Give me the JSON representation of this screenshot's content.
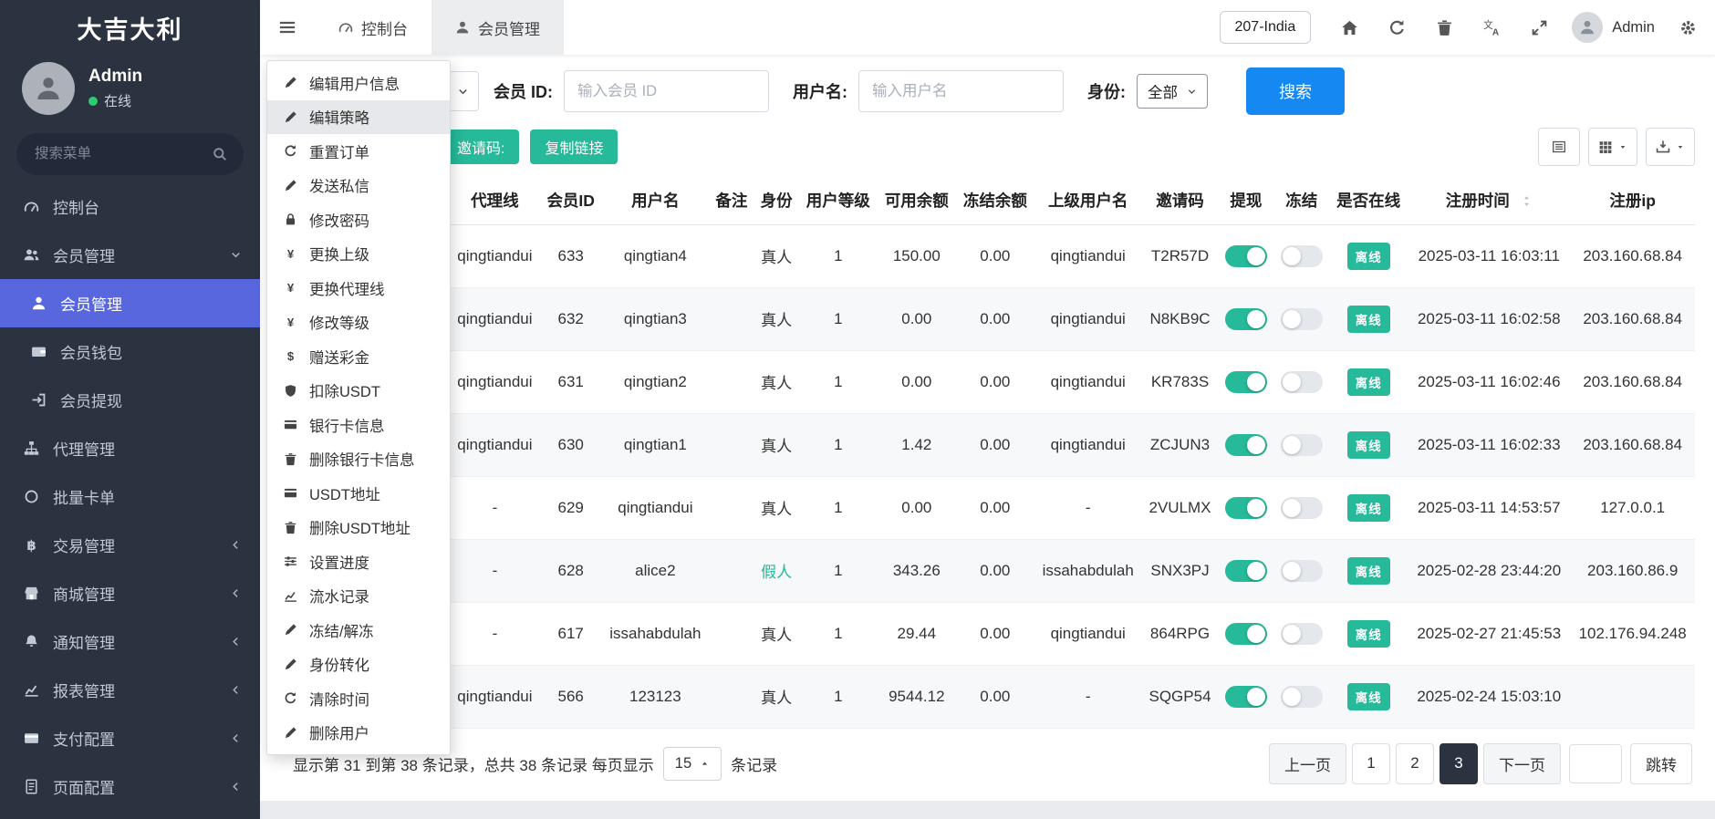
{
  "colors": {
    "accent_teal": "#26b99a",
    "primary_blue": "#1688f2",
    "active_indigo": "#5867dd",
    "sidebar_dark": "#2b3240",
    "online_green": "#2ecc71"
  },
  "sidebar": {
    "title": "大吉大利",
    "user_name": "Admin",
    "user_status": "在线",
    "search_placeholder": "搜索菜单",
    "items": [
      {
        "label": "控制台",
        "icon": "dashboard"
      },
      {
        "label": "会员管理",
        "icon": "users",
        "expanded": true,
        "children": [
          {
            "label": "会员管理",
            "icon": "user",
            "active": true
          },
          {
            "label": "会员钱包",
            "icon": "wallet"
          },
          {
            "label": "会员提现",
            "icon": "withdraw"
          }
        ]
      },
      {
        "label": "代理管理",
        "icon": "sitemap"
      },
      {
        "label": "批量卡单",
        "icon": "circle"
      },
      {
        "label": "交易管理",
        "icon": "bitcoin",
        "collapsible": true
      },
      {
        "label": "商城管理",
        "icon": "store",
        "collapsible": true
      },
      {
        "label": "通知管理",
        "icon": "bell",
        "collapsible": true
      },
      {
        "label": "报表管理",
        "icon": "chart",
        "collapsible": true
      },
      {
        "label": "支付配置",
        "icon": "card",
        "collapsible": true
      },
      {
        "label": "页面配置",
        "icon": "page",
        "collapsible": true
      }
    ]
  },
  "topbar": {
    "tabs": [
      {
        "label": "控制台",
        "icon": "dashboard"
      },
      {
        "label": "会员管理",
        "icon": "user",
        "active": true
      }
    ],
    "region_label": "207-India",
    "user_name": "Admin"
  },
  "context_menu": {
    "items": [
      {
        "label": "编辑用户信息",
        "icon": "pencil"
      },
      {
        "label": "编辑策略",
        "icon": "pencil",
        "highlighted": true
      },
      {
        "label": "重置订单",
        "icon": "refresh"
      },
      {
        "label": "发送私信",
        "icon": "pencil"
      },
      {
        "label": "修改密码",
        "icon": "lock"
      },
      {
        "label": "更换上级",
        "icon": "yen"
      },
      {
        "label": "更换代理线",
        "icon": "yen"
      },
      {
        "label": "修改等级",
        "icon": "yen"
      },
      {
        "label": "赠送彩金",
        "icon": "dollar"
      },
      {
        "label": "扣除USDT",
        "icon": "shield"
      },
      {
        "label": "银行卡信息",
        "icon": "card"
      },
      {
        "label": "删除银行卡信息",
        "icon": "trash"
      },
      {
        "label": "USDT地址",
        "icon": "card"
      },
      {
        "label": "删除USDT地址",
        "icon": "trash"
      },
      {
        "label": "设置进度",
        "icon": "sliders"
      },
      {
        "label": "流水记录",
        "icon": "chart"
      },
      {
        "label": "冻结/解冻",
        "icon": "pencil"
      },
      {
        "label": "身份转化",
        "icon": "pencil"
      },
      {
        "label": "清除时间",
        "icon": "refresh"
      },
      {
        "label": "删除用户",
        "icon": "pencil"
      }
    ]
  },
  "filters": {
    "member_id_label": "会员 ID:",
    "member_id_placeholder": "输入会员 ID",
    "username_label": "用户名:",
    "username_placeholder": "输入用户名",
    "identity_label": "身份:",
    "identity_value": "全部",
    "search_button": "搜索"
  },
  "actions": {
    "invite_code_button": "邀请码:",
    "copy_link_button": "复制链接"
  },
  "table": {
    "columns": [
      {
        "label": "代理线"
      },
      {
        "label": "会员ID"
      },
      {
        "label": "用户名"
      },
      {
        "label": "备注"
      },
      {
        "label": "身份"
      },
      {
        "label": "用户等级"
      },
      {
        "label": "可用余额"
      },
      {
        "label": "冻结余额"
      },
      {
        "label": "上级用户名"
      },
      {
        "label": "邀请码"
      },
      {
        "label": "提现"
      },
      {
        "label": "冻结"
      },
      {
        "label": "是否在线"
      },
      {
        "label": "注册时间",
        "sortable": true
      },
      {
        "label": "注册ip"
      }
    ],
    "rows": [
      {
        "agent_line": "qingtiandui",
        "member_id": "633",
        "username": "qingtian4",
        "remark": "",
        "identity": "真人",
        "identity_type": "real",
        "level": "1",
        "balance": "150.00",
        "frozen_balance": "0.00",
        "parent": "qingtiandui",
        "invite_code": "T2R57D",
        "withdraw_on": true,
        "freeze_on": false,
        "online_status": "离线",
        "reg_time": "2025-03-11 16:03:11",
        "reg_ip": "203.160.68.84"
      },
      {
        "agent_line": "qingtiandui",
        "member_id": "632",
        "username": "qingtian3",
        "remark": "",
        "identity": "真人",
        "identity_type": "real",
        "level": "1",
        "balance": "0.00",
        "frozen_balance": "0.00",
        "parent": "qingtiandui",
        "invite_code": "N8KB9C",
        "withdraw_on": true,
        "freeze_on": false,
        "online_status": "离线",
        "reg_time": "2025-03-11 16:02:58",
        "reg_ip": "203.160.68.84"
      },
      {
        "agent_line": "qingtiandui",
        "member_id": "631",
        "username": "qingtian2",
        "remark": "",
        "identity": "真人",
        "identity_type": "real",
        "level": "1",
        "balance": "0.00",
        "frozen_balance": "0.00",
        "parent": "qingtiandui",
        "invite_code": "KR783S",
        "withdraw_on": true,
        "freeze_on": false,
        "online_status": "离线",
        "reg_time": "2025-03-11 16:02:46",
        "reg_ip": "203.160.68.84"
      },
      {
        "agent_line": "qingtiandui",
        "member_id": "630",
        "username": "qingtian1",
        "remark": "",
        "identity": "真人",
        "identity_type": "real",
        "level": "1",
        "balance": "1.42",
        "frozen_balance": "0.00",
        "parent": "qingtiandui",
        "invite_code": "ZCJUN3",
        "withdraw_on": true,
        "freeze_on": false,
        "online_status": "离线",
        "reg_time": "2025-03-11 16:02:33",
        "reg_ip": "203.160.68.84"
      },
      {
        "agent_line": "-",
        "member_id": "629",
        "username": "qingtiandui",
        "remark": "",
        "identity": "真人",
        "identity_type": "real",
        "level": "1",
        "balance": "0.00",
        "frozen_balance": "0.00",
        "parent": "-",
        "invite_code": "2VULMX",
        "withdraw_on": true,
        "freeze_on": false,
        "online_status": "离线",
        "reg_time": "2025-03-11 14:53:57",
        "reg_ip": "127.0.0.1"
      },
      {
        "agent_line": "-",
        "member_id": "628",
        "username": "alice2",
        "remark": "",
        "identity": "假人",
        "identity_type": "fake",
        "level": "1",
        "balance": "343.26",
        "frozen_balance": "0.00",
        "parent": "issahabdulah",
        "invite_code": "SNX3PJ",
        "withdraw_on": true,
        "freeze_on": false,
        "online_status": "离线",
        "reg_time": "2025-02-28 23:44:20",
        "reg_ip": "203.160.86.9"
      },
      {
        "agent_line": "-",
        "member_id": "617",
        "username": "issahabdulah",
        "remark": "",
        "identity": "真人",
        "identity_type": "real",
        "level": "1",
        "balance": "29.44",
        "frozen_balance": "0.00",
        "parent": "qingtiandui",
        "invite_code": "864RPG",
        "withdraw_on": true,
        "freeze_on": false,
        "online_status": "离线",
        "reg_time": "2025-02-27 21:45:53",
        "reg_ip": "102.176.94.248"
      },
      {
        "agent_line": "qingtiandui",
        "member_id": "566",
        "username": "123123",
        "remark": "",
        "identity": "真人",
        "identity_type": "real",
        "level": "1",
        "balance": "9544.12",
        "frozen_balance": "0.00",
        "parent": "-",
        "invite_code": "SQGP54",
        "withdraw_on": true,
        "freeze_on": false,
        "online_status": "离线",
        "reg_time": "2025-02-24 15:03:10",
        "reg_ip": ""
      }
    ]
  },
  "footer": {
    "summary_prefix": "显示第 31 到第 38 条记录，总共 38 条记录 每页显示",
    "page_size": "15",
    "summary_suffix": "条记录",
    "prev": "上一页",
    "pages": [
      "1",
      "2",
      "3"
    ],
    "active_page": "3",
    "next": "下一页",
    "jump_label": "跳转"
  }
}
